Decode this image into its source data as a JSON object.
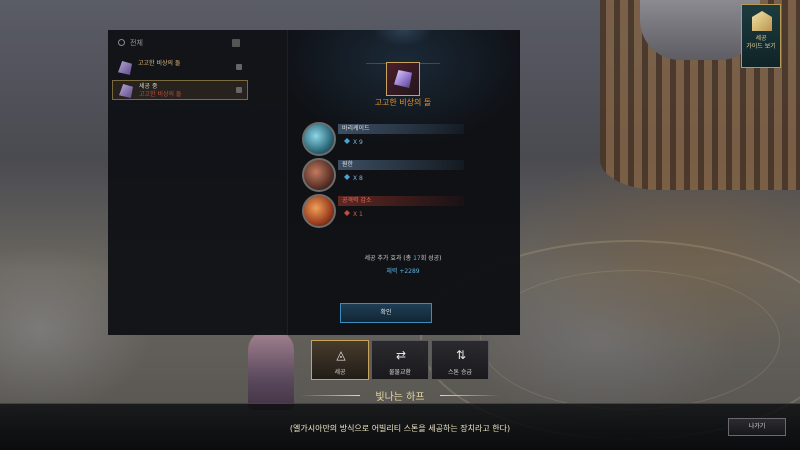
{
  "guide": {
    "label_1": "세공",
    "label_2": "가이드 보기"
  },
  "list": {
    "search_label": "전체",
    "items": [
      {
        "line1": "고고한 비상의 돌",
        "line2": ""
      },
      {
        "line1": "세공 중",
        "line2": "고고한 비상의 돌"
      }
    ]
  },
  "result": {
    "item_name": "고고한 비상의 돌",
    "stones": [
      {
        "name": "바리케이드",
        "count": "X 9",
        "tone": "blue"
      },
      {
        "name": "원한",
        "count": "X 8",
        "tone": "blue"
      },
      {
        "name": "공격력 감소",
        "count": "X 1",
        "tone": "red"
      }
    ],
    "effect_title_prefix": "세공 추가 효과 (총 ",
    "effect_title_count": "17",
    "effect_title_suffix": "회 성공)",
    "effect_value": "체력 +2289",
    "confirm_label": "확인"
  },
  "tabs": [
    {
      "label": "세공",
      "glyph": "◬",
      "active": true
    },
    {
      "label": "물물교환",
      "glyph": "⇄",
      "active": false
    },
    {
      "label": "스톤 승급",
      "glyph": "⇅",
      "active": false
    }
  ],
  "npc_name": "빛나는 하프",
  "subtitle": "(엘가시아만의 방식으로 어빌리티 스톤을 세공하는 장치라고 한다)",
  "exit_label": "나가기",
  "colors": {
    "accent_gold": "#c9a25b",
    "item_title_orange": "#e3912e",
    "positive_blue": "#5fb3e0",
    "negative_red": "#c84a3a"
  }
}
